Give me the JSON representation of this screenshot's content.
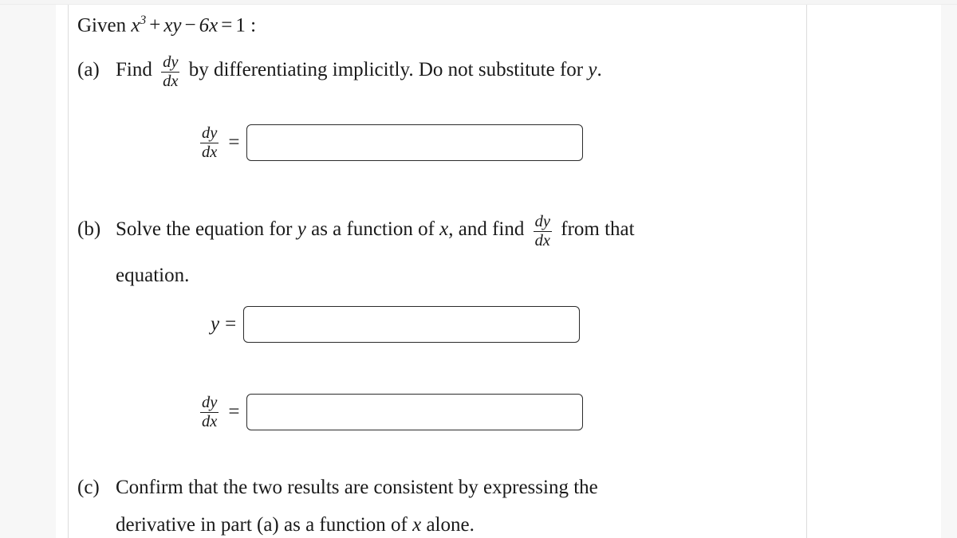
{
  "problem": {
    "given": {
      "prefix": "Given",
      "lhs_base": "x",
      "lhs_exponent": "3",
      "term_plus": "+",
      "term_xy": "xy",
      "term_minus": "−",
      "term_6x": "6x",
      "equals": "=",
      "rhs": "1",
      "colon": ":"
    },
    "parts": [
      {
        "label": "(a)",
        "text_before_frac": "Find",
        "fraction": {
          "numerator": "dy",
          "denominator": "dx"
        },
        "text_after_frac": "by differentiating implicitly.  Do not substitute for",
        "trailing_var": "y",
        "trailing_punct": "."
      },
      {
        "label": "(b)",
        "text_before_var": "Solve the equation for",
        "var1": "y",
        "text_middle": "as a function of",
        "var2": "x",
        "text_before_frac": ", and find",
        "fraction": {
          "numerator": "dy",
          "denominator": "dx"
        },
        "text_after_frac": "from that",
        "continuation": "equation."
      },
      {
        "label": "(c)",
        "line1": "Confirm that the two results are consistent by expressing the",
        "line2_before_var": "derivative in part (a) as a function of",
        "line2_var": "x",
        "line2_after_var": "alone."
      }
    ],
    "answers": [
      {
        "id": "answer-dydx-implicit",
        "label_type": "fraction",
        "label_numerator": "dy",
        "label_denominator": "dx",
        "equals": "=",
        "value": "",
        "placeholder": ""
      },
      {
        "id": "answer-y-explicit",
        "label_type": "variable",
        "label_text": "y",
        "equals": "=",
        "value": "",
        "placeholder": ""
      },
      {
        "id": "answer-dydx-explicit",
        "label_type": "fraction",
        "label_numerator": "dy",
        "label_denominator": "dx",
        "equals": "=",
        "value": "",
        "placeholder": ""
      }
    ]
  },
  "theme": {
    "page_background": "#ffffff",
    "rail_background": "#f7f7f7",
    "rule_color": "#dcdcdc",
    "text_color": "#1a1a1a",
    "input_border_color": "#2b2b2b"
  }
}
